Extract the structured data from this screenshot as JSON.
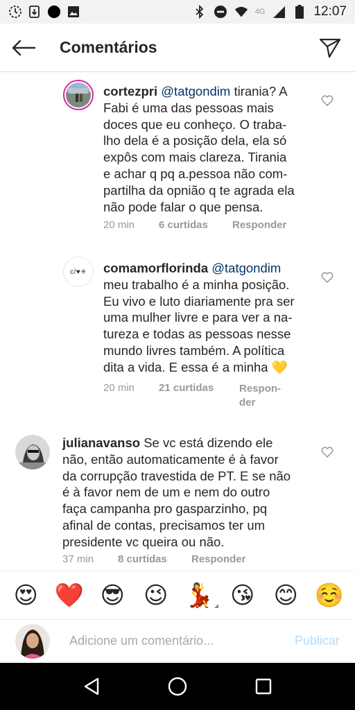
{
  "status_bar": {
    "time": "12:07",
    "network": "4G",
    "icons": [
      "sync-icon",
      "download-icon",
      "record-dot-icon",
      "image-icon",
      "bluetooth-icon",
      "do-not-disturb-icon",
      "wifi-icon",
      "signal-icon",
      "battery-icon"
    ]
  },
  "header": {
    "title": "Comentários",
    "back_icon": "arrow-left-icon",
    "share_icon": "paper-plane-icon"
  },
  "comments": [
    {
      "username": "cortezpri",
      "mention": "@tatgondim",
      "lines": [
        "tirania? A",
        "Fabi é uma das pessoas mais",
        "doces que eu conheço. O traba-",
        "lho dela é a posição dela, ela só",
        "expôs com mais clareza. Tirania",
        "e achar q pq a.pessoa não com-",
        "partilha da opnião q te agrada ela",
        "não pode falar o que pensa."
      ],
      "time": "20 min",
      "likes": "6 curtidas",
      "reply": "Responder"
    },
    {
      "username": "comamorflorinda",
      "mention": "@tatgondim",
      "avatar_text": "c/♥✳",
      "lines": [
        "meu trabalho é a minha posição.",
        "Eu vivo e luto diariamente pra ser",
        "uma mulher livre e para ver a na-",
        "tureza e todas as pessoas nesse",
        "mundo livres também. A política",
        "dita a vida. E essa é a minha 💛"
      ],
      "time": "20 min",
      "likes": "21 curtidas",
      "reply_line1": "Respon-",
      "reply_line2": "der"
    },
    {
      "username": "julianavanso",
      "lines": [
        "Se vc está dizendo ele",
        "não,  então automaticamente é à favor",
        "da corrupção travestida de PT. E se não",
        "é à favor nem de um e nem do outro",
        "faça campanha pro gasparzinho, pq",
        "afinal de contas, precisamos ter um",
        "presidente vc queira ou não."
      ],
      "time": "37 min",
      "likes": "8 curtidas",
      "reply": "Responder"
    }
  ],
  "emoji_bar": [
    "😍",
    "❤️",
    "😎",
    "😉",
    "💃",
    "😘",
    "😊",
    "☺️"
  ],
  "add_comment": {
    "placeholder": "Adicione um comentário...",
    "publish_label": "Publicar"
  },
  "nav_bar": {
    "icons": [
      "back-triangle-icon",
      "home-circle-icon",
      "recents-square-icon"
    ]
  },
  "colors": {
    "mention": "#003569",
    "meta": "#999999",
    "publish_disabled": "#b3dbff",
    "nav_background": "#000000",
    "status_background": "#f2f2f2"
  }
}
